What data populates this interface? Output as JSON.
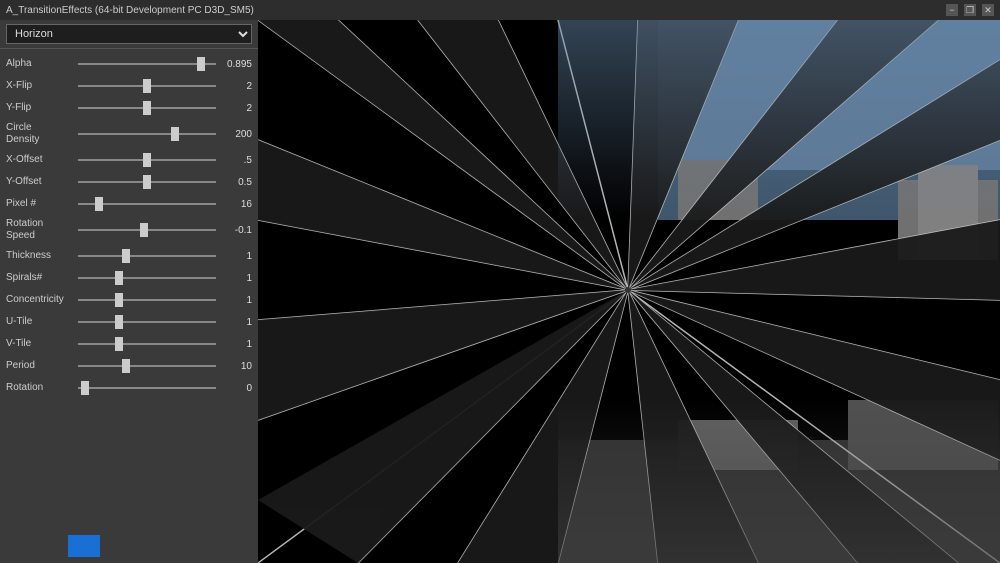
{
  "titlebar": {
    "title": "A_TransitionEffects (64-bit Development PC D3D_SM5)",
    "min": "−",
    "restore": "❐",
    "close": "✕"
  },
  "dropdown": {
    "label": "Horizon",
    "options": [
      "Horizon"
    ]
  },
  "sliders": [
    {
      "id": "alpha",
      "label": "Alpha",
      "value": "0.895",
      "percent": 89
    },
    {
      "id": "x-flip",
      "label": "X-Flip",
      "value": "2",
      "percent": 50
    },
    {
      "id": "y-flip",
      "label": "Y-Flip",
      "value": "2",
      "percent": 50
    },
    {
      "id": "circle-density",
      "label": "Circle\nDensity",
      "value": "200",
      "percent": 70,
      "tall": true
    },
    {
      "id": "x-offset",
      "label": "X-Offset",
      "value": ".5",
      "percent": 50
    },
    {
      "id": "y-offset",
      "label": "Y-Offset",
      "value": "0.5",
      "percent": 50
    },
    {
      "id": "pixel-hash",
      "label": "Pixel #",
      "value": "16",
      "percent": 15
    },
    {
      "id": "rotation-speed",
      "label": "Rotation\nSpeed",
      "value": "-0.1",
      "percent": 48,
      "tall": true
    },
    {
      "id": "thickness",
      "label": "Thickness",
      "value": "1",
      "percent": 35
    },
    {
      "id": "spirals-hash",
      "label": "Spirals#",
      "value": "1",
      "percent": 30
    },
    {
      "id": "concentricity",
      "label": "Concentricity",
      "value": "1",
      "percent": 30
    },
    {
      "id": "u-tile",
      "label": "U-Tile",
      "value": "1",
      "percent": 30
    },
    {
      "id": "v-tile",
      "label": "V-Tile",
      "value": "1",
      "percent": 30
    },
    {
      "id": "period",
      "label": "Period",
      "value": "10",
      "percent": 35
    },
    {
      "id": "rotation",
      "label": "Rotation",
      "value": "0",
      "percent": 5
    }
  ],
  "color_swatch": {
    "color": "#1a6fd4",
    "label": "Color Swatch"
  },
  "visualization": {
    "bg_color": "#000000",
    "accent": "#cccccc"
  }
}
